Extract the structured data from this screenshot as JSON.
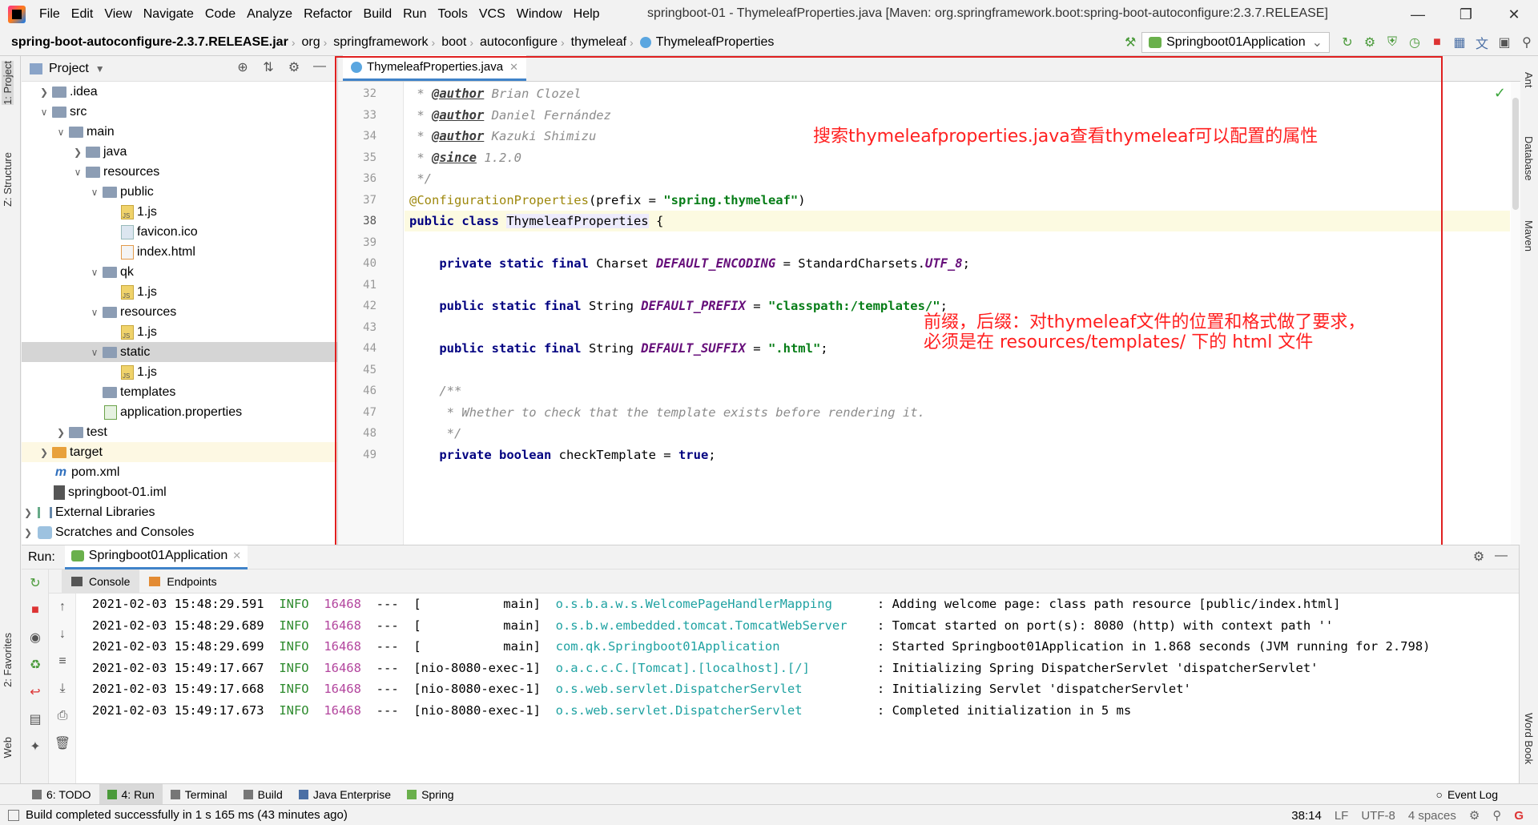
{
  "menu": {
    "items": [
      "File",
      "Edit",
      "View",
      "Navigate",
      "Code",
      "Analyze",
      "Refactor",
      "Build",
      "Run",
      "Tools",
      "VCS",
      "Window",
      "Help"
    ],
    "window_title": "springboot-01 - ThymeleafProperties.java [Maven: org.springframework.boot:spring-boot-autoconfigure:2.3.7.RELEASE]"
  },
  "breadcrumb": [
    "spring-boot-autoconfigure-2.3.7.RELEASE.jar",
    "org",
    "springframework",
    "boot",
    "autoconfigure",
    "thymeleaf",
    "ThymeleafProperties"
  ],
  "run_config": "Springboot01Application",
  "left_stripe": {
    "project": "1: Project",
    "structure": "Z: Structure",
    "favorites": "2: Favorites",
    "web": "Web"
  },
  "right_stripe": {
    "ant": "Ant",
    "database": "Database",
    "maven": "Maven",
    "wordbook": "Word Book"
  },
  "project_panel": {
    "title": "Project",
    "tree": [
      {
        "label": ".idea",
        "type": "folder",
        "indent": 0,
        "arrow": "right"
      },
      {
        "label": "src",
        "type": "folder",
        "indent": 0,
        "arrow": "down"
      },
      {
        "label": "main",
        "type": "folder",
        "indent": 1,
        "arrow": "down"
      },
      {
        "label": "java",
        "type": "folder",
        "indent": 2,
        "arrow": "right"
      },
      {
        "label": "resources",
        "type": "folder",
        "indent": 2,
        "arrow": "down"
      },
      {
        "label": "public",
        "type": "folder",
        "indent": 3,
        "arrow": "down"
      },
      {
        "label": "1.js",
        "type": "js",
        "indent": 4,
        "arrow": ""
      },
      {
        "label": "favicon.ico",
        "type": "ico",
        "indent": 4,
        "arrow": ""
      },
      {
        "label": "index.html",
        "type": "html",
        "indent": 4,
        "arrow": ""
      },
      {
        "label": "qk",
        "type": "folder",
        "indent": 3,
        "arrow": "down"
      },
      {
        "label": "1.js",
        "type": "js",
        "indent": 4,
        "arrow": ""
      },
      {
        "label": "resources",
        "type": "folder",
        "indent": 3,
        "arrow": "down"
      },
      {
        "label": "1.js",
        "type": "js",
        "indent": 4,
        "arrow": ""
      },
      {
        "label": "static",
        "type": "folder",
        "indent": 3,
        "arrow": "down",
        "selected": true
      },
      {
        "label": "1.js",
        "type": "js",
        "indent": 4,
        "arrow": ""
      },
      {
        "label": "templates",
        "type": "folder",
        "indent": 3,
        "arrow": ""
      },
      {
        "label": "application.properties",
        "type": "prop",
        "indent": 3,
        "arrow": ""
      },
      {
        "label": "test",
        "type": "folder",
        "indent": 1,
        "arrow": "right"
      },
      {
        "label": "target",
        "type": "folder-orange",
        "indent": 0,
        "arrow": "right",
        "highlight": true
      },
      {
        "label": "pom.xml",
        "type": "maven",
        "indent": 0,
        "arrow": ""
      },
      {
        "label": "springboot-01.iml",
        "type": "iml",
        "indent": 0,
        "arrow": ""
      },
      {
        "label": "External Libraries",
        "type": "lib",
        "indent": -1,
        "arrow": "right"
      },
      {
        "label": "Scratches and Consoles",
        "type": "scratch",
        "indent": -1,
        "arrow": "right"
      }
    ]
  },
  "editor": {
    "tab_label": "ThymeleafProperties.java",
    "current_line": 38,
    "lines": [
      {
        "n": "32",
        "html": "<span class=\"doc\"> * <span class=\"tag\">@author</span> Brian Clozel</span>"
      },
      {
        "n": "33",
        "html": "<span class=\"doc\"> * <span class=\"tag\">@author</span> Daniel Fernández</span>"
      },
      {
        "n": "34",
        "html": "<span class=\"doc\"> * <span class=\"tag\">@author</span> Kazuki Shimizu</span>"
      },
      {
        "n": "35",
        "html": "<span class=\"doc\"> * <span class=\"tag\">@since</span> 1.2.0</span>"
      },
      {
        "n": "36",
        "html": "<span class=\"doc\"> */</span>"
      },
      {
        "n": "37",
        "html": "<span class=\"ann\">@ConfigurationProperties</span>(prefix = <span class=\"str\">\"spring.thymeleaf\"</span>)"
      },
      {
        "n": "38",
        "html": "<span class=\"kw\">public class</span> <span class=\"cls-hl\">ThymeleafProperties</span> {"
      },
      {
        "n": "39",
        "html": ""
      },
      {
        "n": "40",
        "html": "    <span class=\"kw\">private static final</span> Charset <span class=\"const\">DEFAULT_ENCODING</span> = StandardCharsets.<span class=\"const\">UTF_8</span>;"
      },
      {
        "n": "41",
        "html": ""
      },
      {
        "n": "42",
        "html": "    <span class=\"kw\">public static final</span> String <span class=\"const\">DEFAULT_PREFIX</span> = <span class=\"str\">\"classpath:/templates/\"</span>;"
      },
      {
        "n": "43",
        "html": ""
      },
      {
        "n": "44",
        "html": "    <span class=\"kw\">public static final</span> String <span class=\"const\">DEFAULT_SUFFIX</span> = <span class=\"str\">\".html\"</span>;"
      },
      {
        "n": "45",
        "html": ""
      },
      {
        "n": "46",
        "html": "    <span class=\"doc\">/**</span>"
      },
      {
        "n": "47",
        "html": "<span class=\"doc\">     * Whether to check that the template exists before rendering it.</span>"
      },
      {
        "n": "48",
        "html": "<span class=\"doc\">     */</span>"
      },
      {
        "n": "49",
        "html": "    <span class=\"kw\">private boolean</span> checkTemplate = <span class=\"kw\">true</span>;"
      }
    ],
    "annotation_1": "搜索thymeleafproperties.java查看thymeleaf可以配置的属性",
    "annotation_2a": "前缀，后缀：对thymeleaf文件的位置和格式做了要求，",
    "annotation_2b": "必须是在 resources/templates/ 下的 html 文件"
  },
  "run_panel": {
    "title": "Run:",
    "tab_label": "Springboot01Application",
    "subtabs": [
      "Console",
      "Endpoints"
    ],
    "log": [
      {
        "ts": "2021-02-03 15:48:29.591",
        "level": "INFO",
        "pid": "16468",
        "sep": "---",
        "thread": "[           main]",
        "logger": "o.s.b.a.w.s.WelcomePageHandlerMapping   ",
        "msg": " : Adding welcome page: class path resource [public/index.html]"
      },
      {
        "ts": "2021-02-03 15:48:29.689",
        "level": "INFO",
        "pid": "16468",
        "sep": "---",
        "thread": "[           main]",
        "logger": "o.s.b.w.embedded.tomcat.TomcatWebServer ",
        "msg": " : Tomcat started on port(s): 8080 (http) with context path ''"
      },
      {
        "ts": "2021-02-03 15:48:29.699",
        "level": "INFO",
        "pid": "16468",
        "sep": "---",
        "thread": "[           main]",
        "logger": "com.qk.Springboot01Application          ",
        "msg": " : Started Springboot01Application in 1.868 seconds (JVM running for 2.798)"
      },
      {
        "ts": "2021-02-03 15:49:17.667",
        "level": "INFO",
        "pid": "16468",
        "sep": "---",
        "thread": "[nio-8080-exec-1]",
        "logger": "o.a.c.c.C.[Tomcat].[localhost].[/]      ",
        "msg": " : Initializing Spring DispatcherServlet 'dispatcherServlet'"
      },
      {
        "ts": "2021-02-03 15:49:17.668",
        "level": "INFO",
        "pid": "16468",
        "sep": "---",
        "thread": "[nio-8080-exec-1]",
        "logger": "o.s.web.servlet.DispatcherServlet       ",
        "msg": " : Initializing Servlet 'dispatcherServlet'"
      },
      {
        "ts": "2021-02-03 15:49:17.673",
        "level": "INFO",
        "pid": "16468",
        "sep": "---",
        "thread": "[nio-8080-exec-1]",
        "logger": "o.s.web.servlet.DispatcherServlet       ",
        "msg": " : Completed initialization in 5 ms"
      }
    ]
  },
  "bottom_tools": {
    "todo": "6: TODO",
    "run": "4: Run",
    "terminal": "Terminal",
    "build": "Build",
    "java_enterprise": "Java Enterprise",
    "spring": "Spring",
    "event_log": "Event Log"
  },
  "status": {
    "message": "Build completed successfully in 1 s 165 ms (43 minutes ago)",
    "position": "38:14",
    "line_sep": "LF",
    "encoding": "UTF-8",
    "indent": "4 spaces"
  }
}
